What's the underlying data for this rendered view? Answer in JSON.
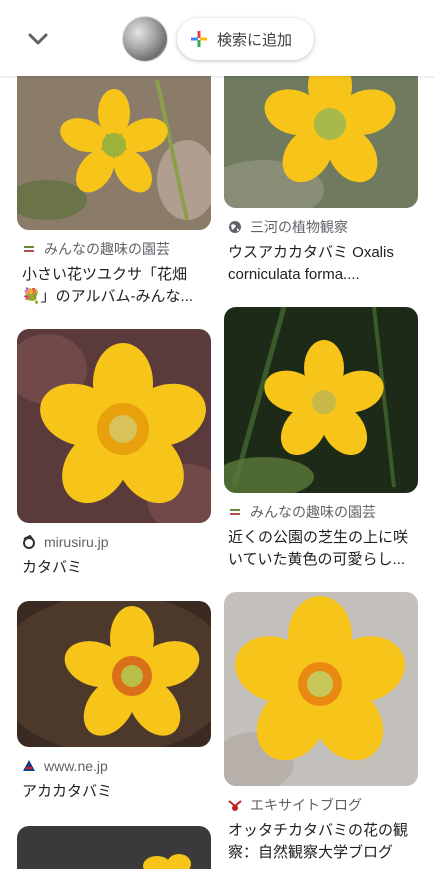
{
  "header": {
    "back_icon": "chevron-down-icon",
    "add_to_search_label": "検索に追加",
    "plus_icon": "google-plus-icon"
  },
  "results": [
    {
      "source": "みんなの趣味の園芸",
      "title_line1": "小さい花ツユクサ「花畑",
      "title_line2": "💐」のアルバム-みんな...",
      "source_icon": "site-logo-icon"
    },
    {
      "source": "三河の植物観察",
      "title_line1": "ウスアカカタバミ Oxalis",
      "title_line2": "corniculata forma....",
      "source_icon": "globe-icon"
    },
    {
      "source": "mirusiru.jp",
      "title_line1": "カタバミ",
      "title_line2": "",
      "source_icon": "site-logo-icon"
    },
    {
      "source": "みんなの趣味の園芸",
      "title_line1": "近くの公園の芝生の上に咲",
      "title_line2": "いていた黄色の可愛らし...",
      "source_icon": "site-logo-icon"
    },
    {
      "source": "www.ne.jp",
      "title_line1": "アカカタバミ",
      "title_line2": "",
      "source_icon": "site-logo-icon"
    },
    {
      "source": "エキサイトブログ",
      "title_line1": "オッタチカタバミの花の観",
      "title_line2": "察：自然観察大学ブログ",
      "source_icon": "site-logo-icon"
    }
  ],
  "colors": {
    "petal": "#f7c51a",
    "petal_dark": "#e8a10c",
    "center": "#9bb33a"
  }
}
